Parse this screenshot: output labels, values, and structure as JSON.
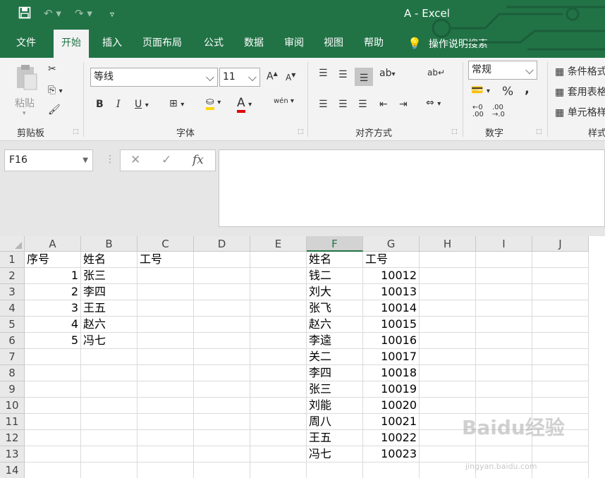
{
  "window": {
    "title": "A  -  Excel"
  },
  "qat": {
    "save_icon": "save-icon",
    "undo_icon": "undo-icon",
    "redo_icon": "redo-icon",
    "customize_icon": "customize-qat-icon"
  },
  "tabs": [
    "文件",
    "开始",
    "插入",
    "页面布局",
    "公式",
    "数据",
    "审阅",
    "视图",
    "帮助"
  ],
  "active_tab": "开始",
  "tell_me": "操作说明搜索",
  "ribbon": {
    "clipboard": {
      "label": "剪贴板",
      "paste": "粘贴"
    },
    "font": {
      "label": "字体",
      "font_name": "等线",
      "font_size": "11",
      "bold": "B",
      "italic": "I",
      "underline": "U",
      "grow": "A",
      "shrink": "A",
      "font_color_glyph": "A",
      "phonetic": "wén"
    },
    "alignment": {
      "label": "对齐方式"
    },
    "number": {
      "label": "数字",
      "format": "常规",
      "percent": "%",
      "comma": ","
    },
    "styles": {
      "label": "样式",
      "conditional": "条件格式",
      "table": "套用表格",
      "cell": "单元格样式"
    }
  },
  "formula_bar": {
    "name_box": "F16",
    "cancel": "✕",
    "enter": "✓",
    "fx": "fx",
    "value": ""
  },
  "columns": [
    "A",
    "B",
    "C",
    "D",
    "E",
    "F",
    "G",
    "H",
    "I",
    "J"
  ],
  "selected_column": "F",
  "rows": [
    "1",
    "2",
    "3",
    "4",
    "5",
    "6",
    "7",
    "8",
    "9",
    "10",
    "11",
    "12",
    "13",
    "14"
  ],
  "sheet": {
    "A": [
      "序号",
      "1",
      "2",
      "3",
      "4",
      "5",
      "",
      "",
      "",
      "",
      "",
      "",
      "",
      ""
    ],
    "B": [
      "姓名",
      "张三",
      "李四",
      "王五",
      "赵六",
      "冯七",
      "",
      "",
      "",
      "",
      "",
      "",
      "",
      ""
    ],
    "C": [
      "工号",
      "",
      "",
      "",
      "",
      "",
      "",
      "",
      "",
      "",
      "",
      "",
      "",
      ""
    ],
    "F": [
      "姓名",
      "钱二",
      "刘大",
      "张飞",
      "赵六",
      "李逵",
      "关二",
      "李四",
      "张三",
      "刘能",
      "周八",
      "王五",
      "冯七",
      ""
    ],
    "G": [
      "工号",
      "10012",
      "10013",
      "10014",
      "10015",
      "10016",
      "10017",
      "10018",
      "10019",
      "10020",
      "10021",
      "10022",
      "10023",
      ""
    ]
  },
  "watermark": {
    "text": "Baidu经验",
    "url": "jingyan.baidu.com"
  },
  "colors": {
    "accent": "#217346"
  }
}
